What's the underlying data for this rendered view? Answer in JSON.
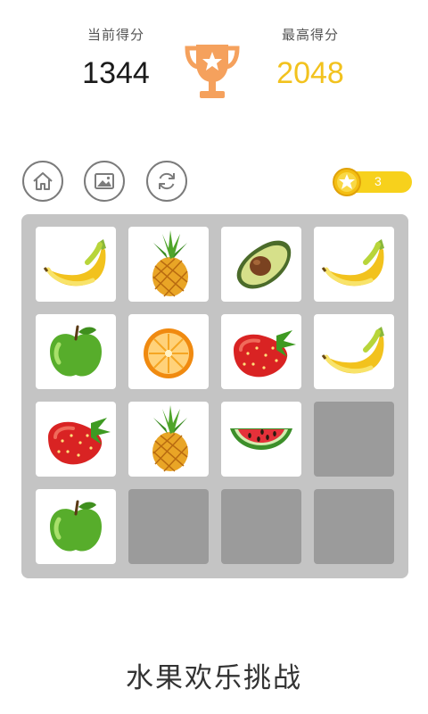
{
  "header": {
    "current_score_label": "当前得分",
    "current_score": "1344",
    "best_score_label": "最高得分",
    "best_score": "2048"
  },
  "toolbar": {
    "coins": "3"
  },
  "colors": {
    "trophy": "#f5a15d",
    "best_score": "#f2c21e",
    "coin_pill": "#f7d11c",
    "board": "#c4c4c4",
    "empty_cell": "#9b9b9b"
  },
  "board": {
    "rows": 4,
    "cols": 4,
    "cells": [
      [
        "banana",
        "pineapple",
        "avocado",
        "banana"
      ],
      [
        "green-apple",
        "orange",
        "strawberry",
        "banana"
      ],
      [
        "strawberry",
        "pineapple",
        "watermelon",
        "empty"
      ],
      [
        "green-apple",
        "empty",
        "empty",
        "empty"
      ]
    ]
  },
  "footer": {
    "title": "水果欢乐挑战"
  }
}
